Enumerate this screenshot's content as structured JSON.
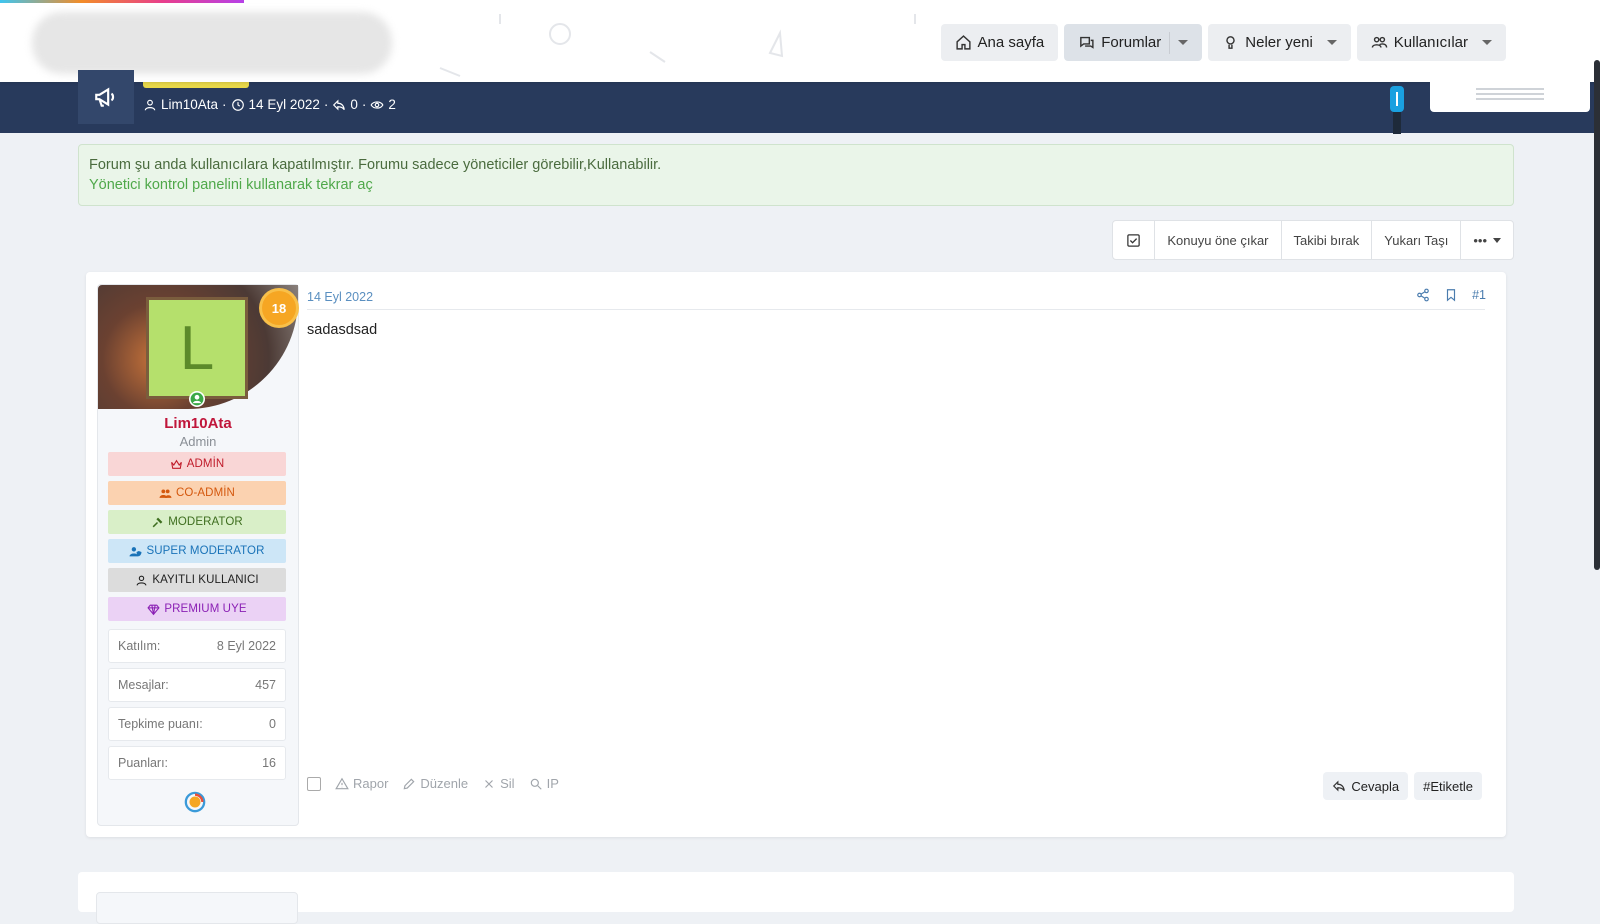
{
  "nav": {
    "home": "Ana sayfa",
    "forums": "Forumlar",
    "whats_new": "Neler yeni",
    "members": "Kullanıcılar"
  },
  "thread": {
    "author": "Lim10Ata",
    "date": "14 Eyl 2022",
    "replies": "0",
    "views": "2"
  },
  "notice": {
    "message": "Forum şu anda kullanıcılara kapatılmıştır. Forumu sadece yöneticiler görebilir,Kullanabilir.",
    "link": "Yönetici kontrol panelini kullanarak tekrar aç"
  },
  "toolbar": {
    "feature": "Konuyu öne çıkar",
    "unwatch": "Takibi bırak",
    "bump": "Yukarı Taşı",
    "more": "•••"
  },
  "user": {
    "avatar_letter": "L",
    "age_badge": "18",
    "name": "Lim10Ata",
    "title": "Admin",
    "banners": [
      {
        "label": "ADMİN"
      },
      {
        "label": "CO-ADMİN"
      },
      {
        "label": "MODERATOR"
      },
      {
        "label": "SUPER MODERATOR"
      },
      {
        "label": "KAYITLI KULLANICI"
      },
      {
        "label": "PREMIUM UYE"
      }
    ],
    "stats": [
      {
        "label": "Katılım:",
        "value": "8 Eyl 2022"
      },
      {
        "label": "Mesajlar:",
        "value": "457"
      },
      {
        "label": "Tepkime puanı:",
        "value": "0"
      },
      {
        "label": "Puanları:",
        "value": "16"
      }
    ]
  },
  "post": {
    "date": "14 Eyl 2022",
    "number": "#1",
    "body": "sadasdsad",
    "footer": {
      "report": "Rapor",
      "edit": "Düzenle",
      "delete": "Sil",
      "ip": "IP"
    },
    "reply": "Cevapla",
    "tag": "#Etiketle"
  },
  "colors": {
    "header_band": "#283a5c",
    "username": "#c0163b",
    "notice_bg": "#eaf5e9",
    "link": "#4fa84a"
  }
}
